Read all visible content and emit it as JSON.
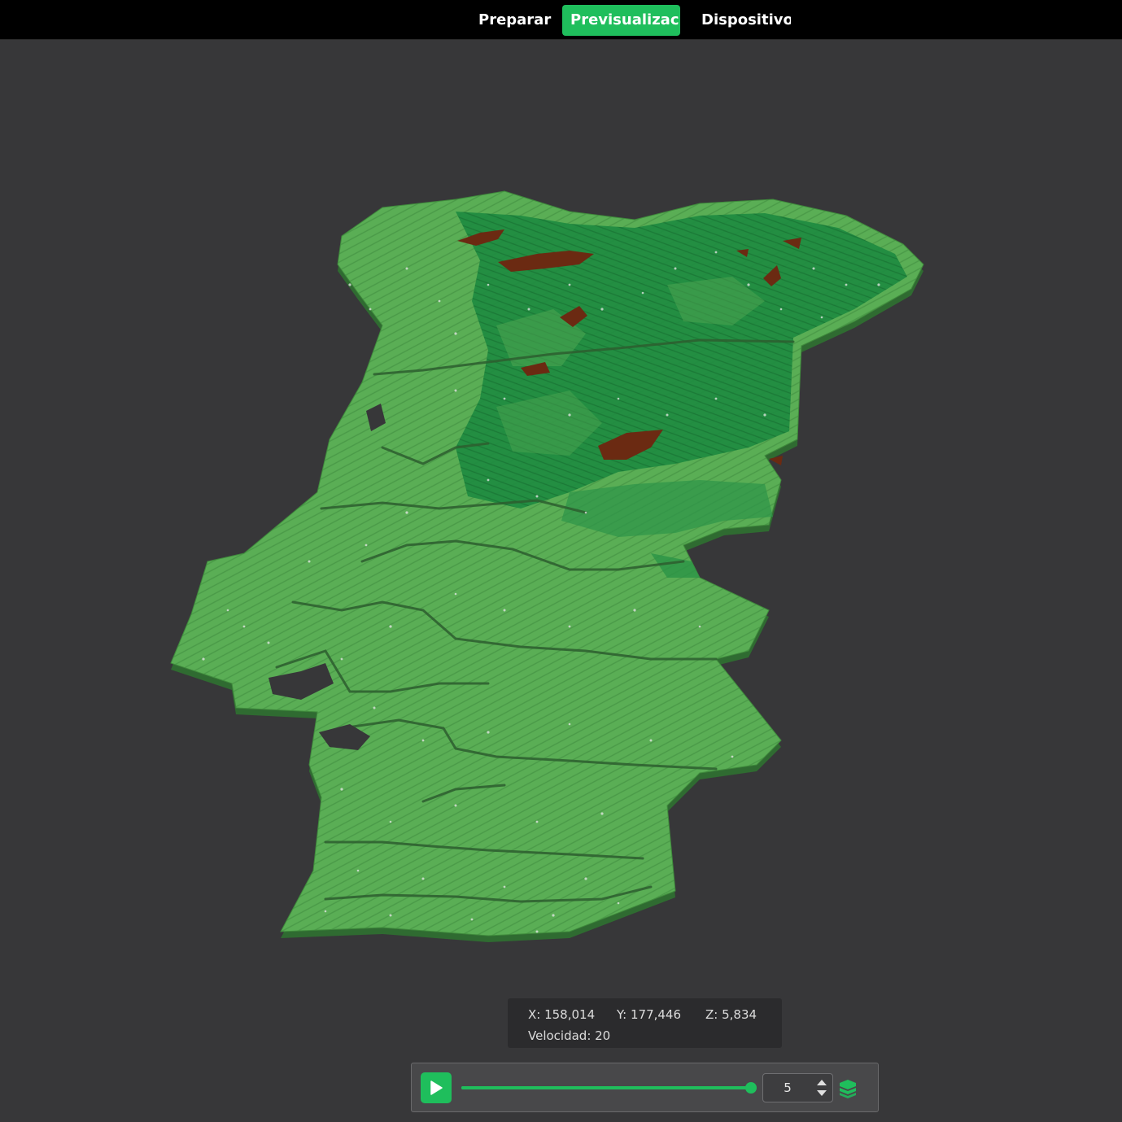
{
  "tabs": [
    {
      "label": "Preparar",
      "active": false
    },
    {
      "label": "Previsualización",
      "active": true
    },
    {
      "label": "Dispositivo",
      "active": false
    }
  ],
  "colors": {
    "accent": "#1fbe5c",
    "background": "#373739",
    "land_light": "#5fb35a",
    "land_dark": "#1e8a3e",
    "peak": "#6b2a12"
  },
  "viewport": {
    "content": "3D voxel terrain preview"
  },
  "coords": {
    "x": "X: 158,014",
    "y": "Y: 177,446",
    "z": "Z: 5,834",
    "speed": "Velocidad: 20"
  },
  "player": {
    "play_icon": "play-icon",
    "progress": 1.0,
    "layer_value": "5",
    "stepper_icon": "up-down-arrows-icon",
    "layers_icon": "layers-icon"
  }
}
